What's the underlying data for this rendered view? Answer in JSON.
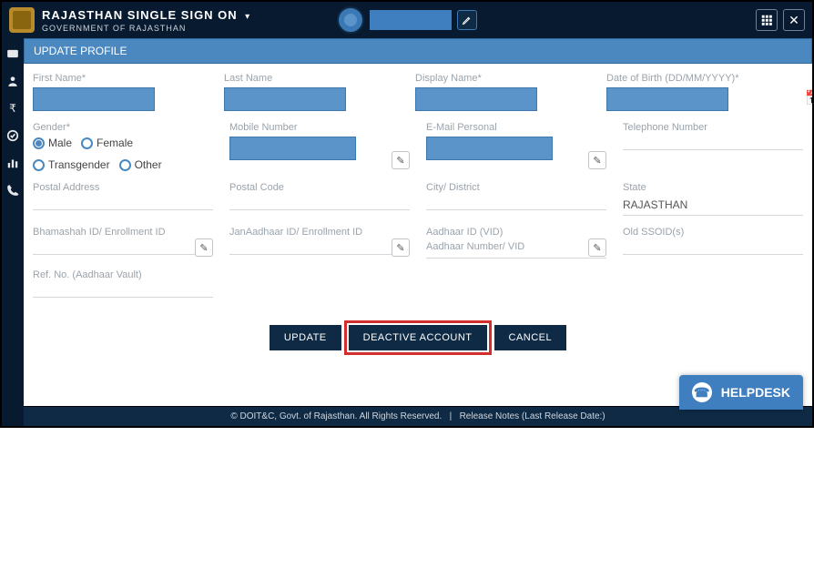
{
  "header": {
    "title": "RAJASTHAN SINGLE SIGN ON",
    "subtitle": "GOVERNMENT OF RAJASTHAN"
  },
  "panel": {
    "title": "UPDATE PROFILE"
  },
  "labels": {
    "first_name": "First Name*",
    "last_name": "Last Name",
    "display_name": "Display Name*",
    "dob": "Date of Birth (DD/MM/YYYY)*",
    "gender": "Gender*",
    "mobile": "Mobile Number",
    "email": "E-Mail Personal",
    "telephone": "Telephone Number",
    "postal_address": "Postal Address",
    "postal_code": "Postal Code",
    "city": "City/ District",
    "state": "State",
    "bhamashah": "Bhamashah ID/ Enrollment ID",
    "janaadhaar": "JanAadhaar ID/ Enrollment ID",
    "aadhaar_id": "Aadhaar ID (VID)",
    "aadhaar_num": "Aadhaar Number/ VID",
    "old_sso": "Old SSOID(s)",
    "ref_no": "Ref. No. (Aadhaar Vault)"
  },
  "values": {
    "state": "RAJASTHAN"
  },
  "gender_options": {
    "male": "Male",
    "female": "Female",
    "transgender": "Transgender",
    "other": "Other"
  },
  "buttons": {
    "update": "UPDATE",
    "deactive": "DEACTIVE ACCOUNT",
    "cancel": "CANCEL"
  },
  "helpdesk": "HELPDESK",
  "footer": {
    "copyright": "© DOIT&C, Govt. of Rajasthan. All Rights Reserved.",
    "sep": "|",
    "release": "Release Notes (Last Release Date:)"
  }
}
